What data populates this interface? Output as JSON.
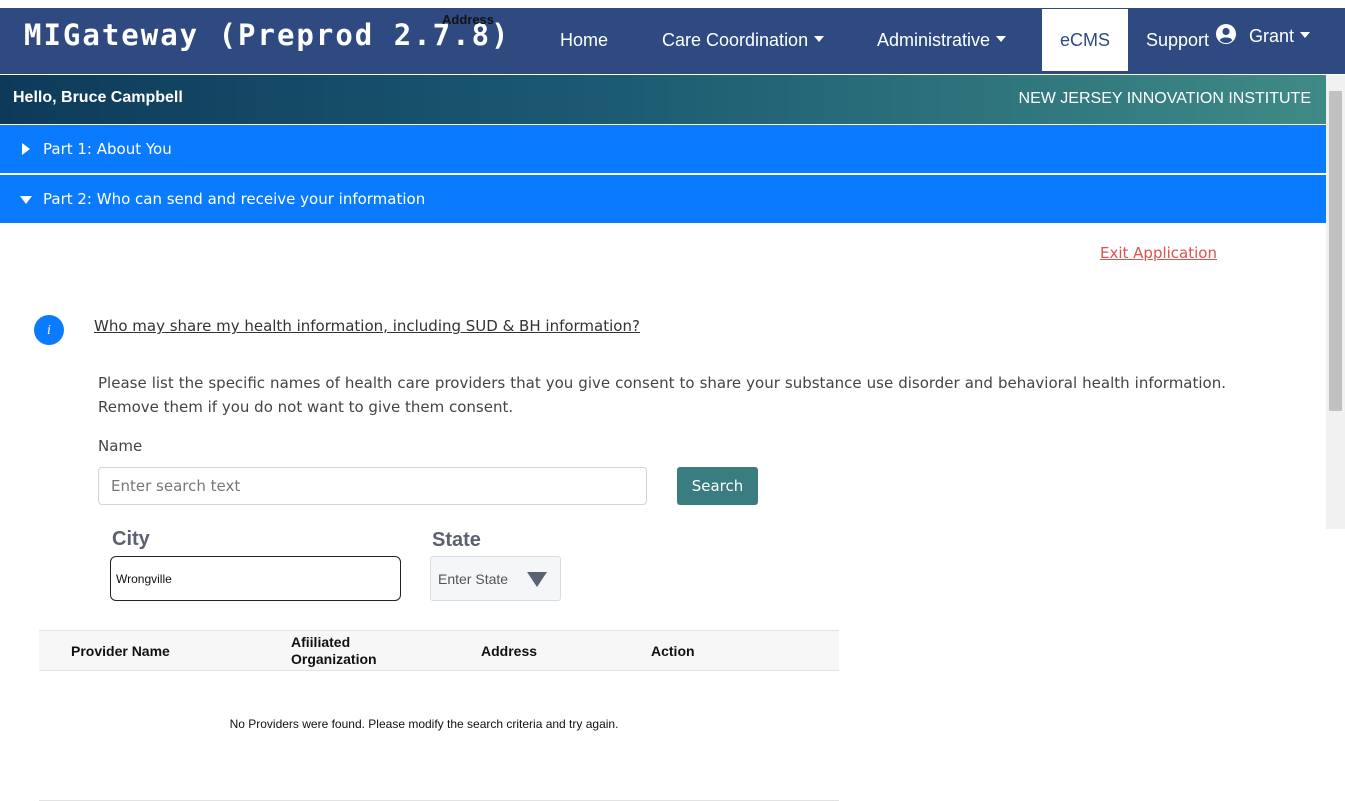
{
  "header": {
    "brand": "MIGateway (Preprod 2.7.8)",
    "overlay_label": "Address",
    "nav": {
      "home": "Home",
      "care_coordination": "Care Coordination",
      "administrative": "Administrative",
      "ecms": "eCMS",
      "support": "Support",
      "user": "Grant"
    }
  },
  "greeting": {
    "hello": "Hello, Bruce Campbell",
    "org": "NEW JERSEY INNOVATION INSTITUTE"
  },
  "accordion": {
    "part1": "Part 1: About You",
    "part2": "Part 2: Who can send and receive your information"
  },
  "content": {
    "exit_label": "Exit Application",
    "info_icon_char": "i",
    "info_link": "Who may share my health information, including SUD & BH information?",
    "description": "Please list the specific names of health care providers that you give consent to share your substance use disorder and behavioral health information. Remove them if you do not want to give them consent.",
    "name_label": "Name",
    "search_placeholder": "Enter search text",
    "search_button": "Search",
    "city_label": "City",
    "city_value": "Wrongville",
    "state_label": "State",
    "state_placeholder": "Enter State"
  },
  "table": {
    "headers": {
      "provider_name": "Provider Name",
      "affiliated_line1": "Afiiliated",
      "affiliated_line2": "Organization",
      "address": "Address",
      "action": "Action"
    },
    "empty_message": "No Providers were found. Please modify the search criteria and try again."
  },
  "icons": {
    "user": "user-circle-icon",
    "info": "info-icon",
    "expand": "caret-right-icon",
    "collapse": "caret-down-icon",
    "dropdown": "triangle-down-icon"
  },
  "colors": {
    "navbar": "#2e4a80",
    "accordion": "#0a7bff",
    "search_button": "#3a7d80",
    "exit_link": "#d9534f"
  }
}
